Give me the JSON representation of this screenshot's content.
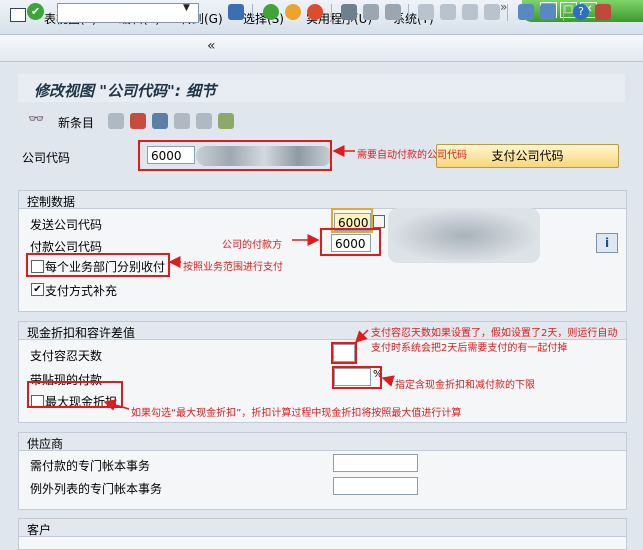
{
  "menu": {
    "items": [
      "表视图(T)",
      "编辑(E)",
      "转到(G)",
      "选择(S)",
      "实用程序(U)",
      "系统(Y)"
    ]
  },
  "page_title": "修改视图 \"公司代码\": 细节",
  "app_toolbar": {
    "new_entries": "新条目"
  },
  "company": {
    "label": "公司代码",
    "value": "6000",
    "button": "支付公司代码"
  },
  "control": {
    "title": "控制数据",
    "sending_label": "发送公司代码",
    "sending_value": "6000",
    "paying_label": "付款公司代码",
    "paying_value": "6000",
    "separate_payment_label": "每个业务部门分别收付",
    "supplement_label": "支付方式补充",
    "supplement_checked": "✔"
  },
  "cash": {
    "title": "现金折扣和容许差值",
    "tolerance_label": "支付容忍天数",
    "tolerance_value": "",
    "discount_label": "带贴现的付款",
    "percent_sign": "%",
    "max_discount_label": "最大现金折扣"
  },
  "vendor": {
    "title": "供应商",
    "gl_required_label": "需付款的专门帐本事务",
    "gl_exception_label": "例外列表的专门帐本事务"
  },
  "customer": {
    "title": "客户"
  },
  "annotations": {
    "auto_payment": "需要自动付款的公司代码",
    "paying_company": "公司的付款方",
    "business_area": "按照业务范围进行支付",
    "tolerance_line1": "支付容忍天数如果设置了，假如设置了2天，则运行自动",
    "tolerance_line2": "支付时系统会把2天后需要支付的有一起付掉",
    "discount_limit": "指定含现金折扣和减付款的下限",
    "max_discount": "如果勾选“最大现金折扣”，折扣计算过程中现金折扣将按照最大值进行计算"
  },
  "colors": {
    "annotation_red": "#e01b1b",
    "sap_green": "#3b9a2c",
    "button_yellow": "#fde9a6"
  }
}
